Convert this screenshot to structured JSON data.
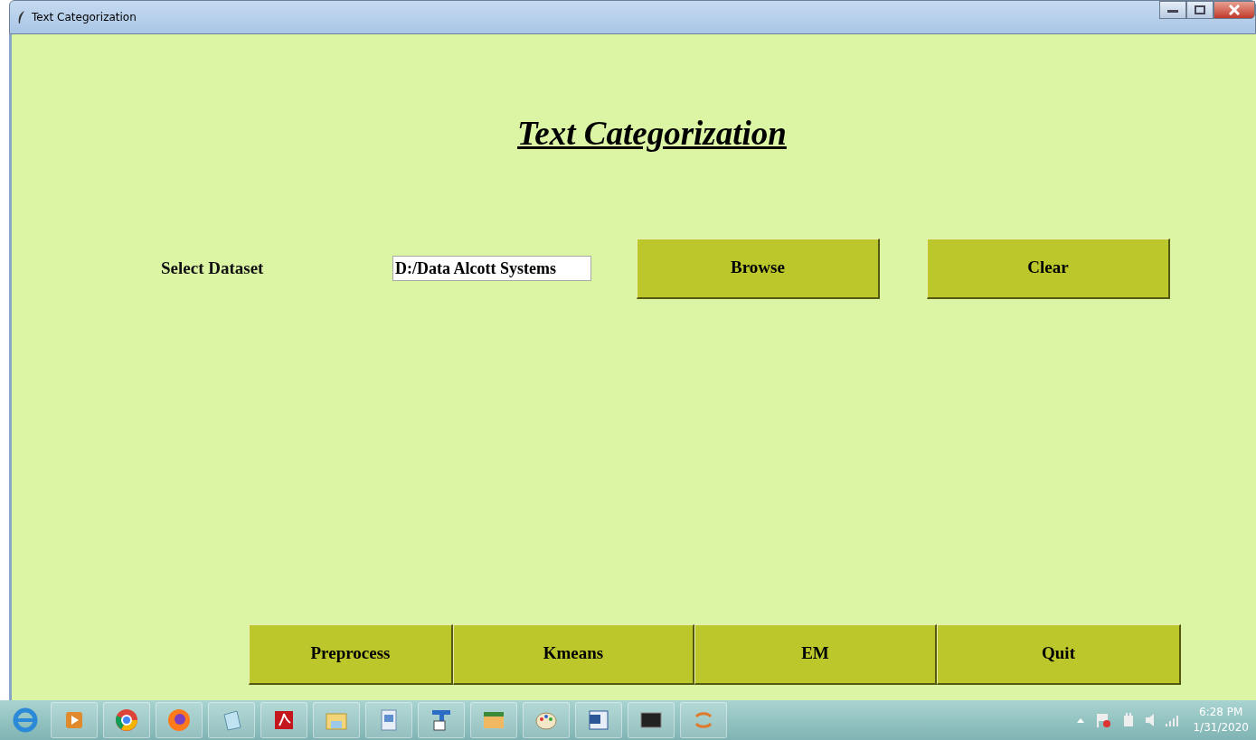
{
  "window": {
    "title": "Text Categorization"
  },
  "heading": "Text Categorization",
  "dataset": {
    "label": "Select Dataset",
    "value": "D:/Data Alcott Systems"
  },
  "top_buttons": [
    "Browse",
    "Clear"
  ],
  "bottom_buttons": [
    "Preprocess",
    "Kmeans",
    "EM",
    "Quit"
  ],
  "taskbar": {
    "time": "6:28 PM",
    "date": "1/31/2020"
  }
}
